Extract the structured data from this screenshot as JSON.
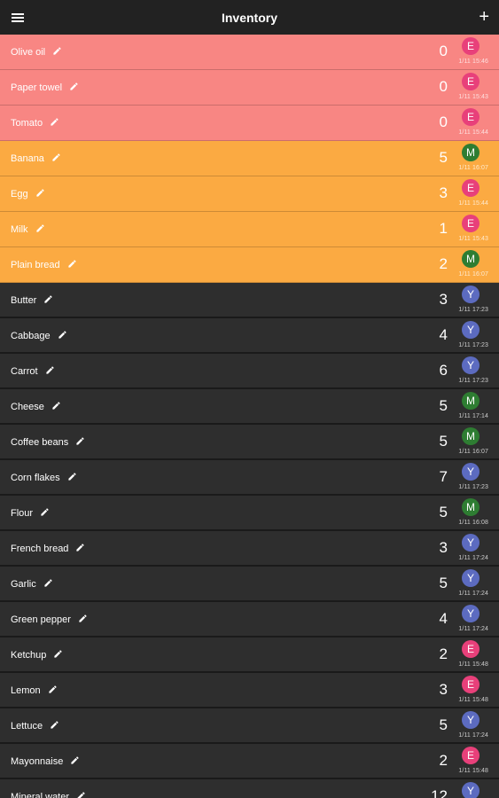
{
  "app": {
    "title": "Inventory",
    "menu_icon": "hamburger-menu-icon",
    "add_icon": "plus-icon",
    "add_label": "+"
  },
  "colors": {
    "empty": "#f88683",
    "low": "#fbaa42",
    "ok": "#2e2e2e",
    "avatar_E": "#e8407a",
    "avatar_M": "#2e7d32",
    "avatar_Y": "#5c6bc0"
  },
  "items": [
    {
      "name": "Olive oil",
      "qty": "0",
      "user": "E",
      "time": "1/11 15:46",
      "status": "empty"
    },
    {
      "name": "Paper towel",
      "qty": "0",
      "user": "E",
      "time": "1/11 15:43",
      "status": "empty"
    },
    {
      "name": "Tomato",
      "qty": "0",
      "user": "E",
      "time": "1/11 15:44",
      "status": "empty"
    },
    {
      "name": "Banana",
      "qty": "5",
      "user": "M",
      "time": "1/11 16:07",
      "status": "low"
    },
    {
      "name": "Egg",
      "qty": "3",
      "user": "E",
      "time": "1/11 15:44",
      "status": "low"
    },
    {
      "name": "Milk",
      "qty": "1",
      "user": "E",
      "time": "1/11 15:43",
      "status": "low"
    },
    {
      "name": "Plain bread",
      "qty": "2",
      "user": "M",
      "time": "1/11 16:07",
      "status": "low"
    },
    {
      "name": "Butter",
      "qty": "3",
      "user": "Y",
      "time": "1/11 17:23",
      "status": "ok"
    },
    {
      "name": "Cabbage",
      "qty": "4",
      "user": "Y",
      "time": "1/11 17:23",
      "status": "ok"
    },
    {
      "name": "Carrot",
      "qty": "6",
      "user": "Y",
      "time": "1/11 17:23",
      "status": "ok"
    },
    {
      "name": "Cheese",
      "qty": "5",
      "user": "M",
      "time": "1/11 17:14",
      "status": "ok"
    },
    {
      "name": "Coffee beans",
      "qty": "5",
      "user": "M",
      "time": "1/11 16:07",
      "status": "ok"
    },
    {
      "name": "Corn flakes",
      "qty": "7",
      "user": "Y",
      "time": "1/11 17:23",
      "status": "ok"
    },
    {
      "name": "Flour",
      "qty": "5",
      "user": "M",
      "time": "1/11 16:08",
      "status": "ok"
    },
    {
      "name": "French bread",
      "qty": "3",
      "user": "Y",
      "time": "1/11 17:24",
      "status": "ok"
    },
    {
      "name": "Garlic",
      "qty": "5",
      "user": "Y",
      "time": "1/11 17:24",
      "status": "ok"
    },
    {
      "name": "Green pepper",
      "qty": "4",
      "user": "Y",
      "time": "1/11 17:24",
      "status": "ok"
    },
    {
      "name": "Ketchup",
      "qty": "2",
      "user": "E",
      "time": "1/11 15:48",
      "status": "ok"
    },
    {
      "name": "Lemon",
      "qty": "3",
      "user": "E",
      "time": "1/11 15:48",
      "status": "ok"
    },
    {
      "name": "Lettuce",
      "qty": "5",
      "user": "Y",
      "time": "1/11 17:24",
      "status": "ok"
    },
    {
      "name": "Mayonnaise",
      "qty": "2",
      "user": "E",
      "time": "1/11 15:48",
      "status": "ok"
    },
    {
      "name": "Mineral water",
      "qty": "12",
      "user": "Y",
      "time": "",
      "status": "ok"
    }
  ]
}
